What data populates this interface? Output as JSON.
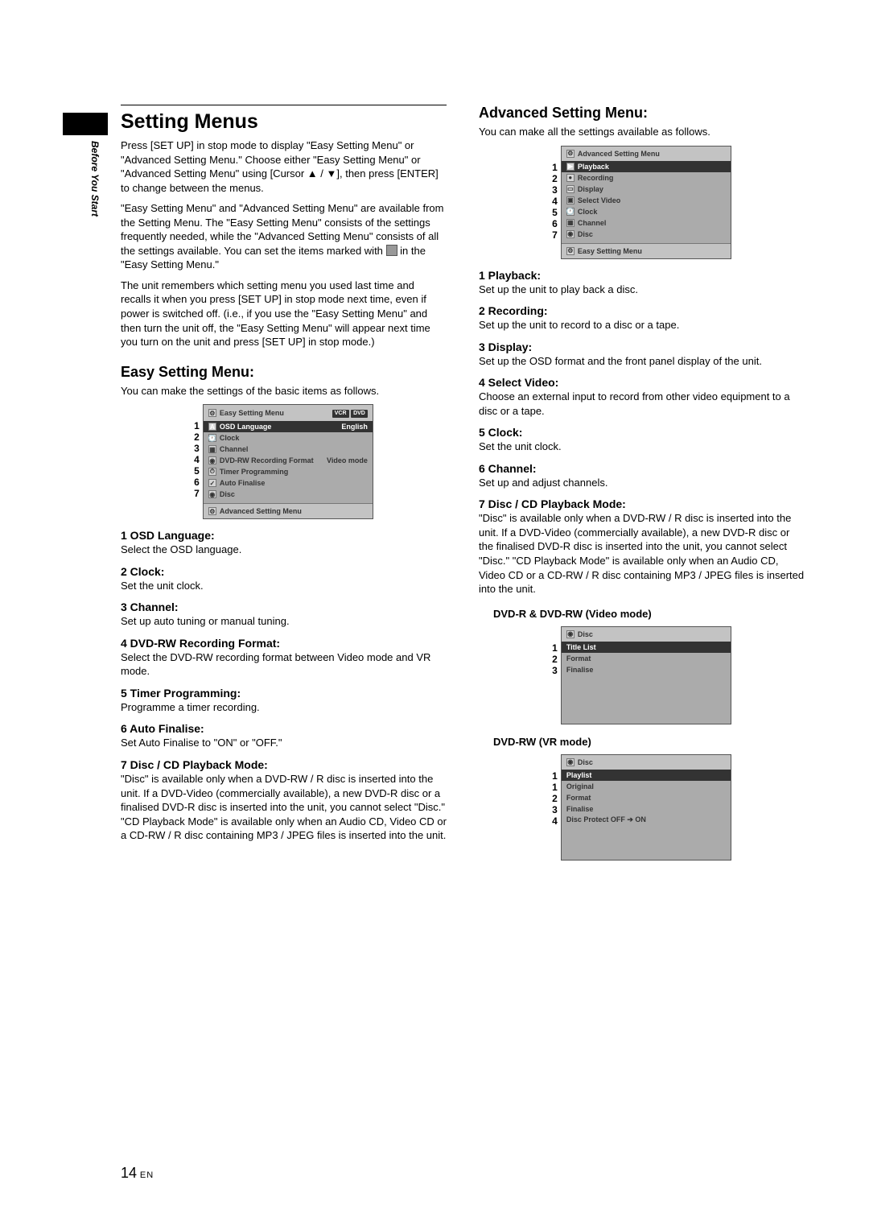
{
  "tab_label": "Before You Start",
  "left": {
    "title": "Setting Menus",
    "intro_a": "Press [SET UP] in stop mode to display \"Easy Setting Menu\" or \"Advanced Setting Menu.\" Choose either \"Easy Setting Menu\" or \"Advanced Setting Menu\" using [Cursor ▲ / ▼], then press [ENTER] to change between the menus.",
    "intro_b_pre": "\"Easy Setting Menu\" and \"Advanced Setting Menu\" are available from the Setting Menu. The \"Easy Setting Menu\" consists of the settings frequently needed, while the \"Advanced Setting Menu\" consists of all the settings available. You can set the items marked with ",
    "intro_b_post": " in the \"Easy Setting Menu.\"",
    "intro_c": "The unit remembers which setting menu you used last time and recalls it when you press [SET UP] in stop mode next time, even if power is switched off. (i.e., if you use the \"Easy Setting Menu\" and then turn the unit off, the \"Easy Setting Menu\" will appear next time you turn on the unit and press [SET UP] in stop mode.)",
    "easy_title": "Easy Setting Menu:",
    "easy_lead": "You can make the settings of the basic items as follows.",
    "easy_osd": {
      "title": "Easy Setting Menu",
      "badges": [
        "VCR",
        "DVD"
      ],
      "rows": [
        {
          "n": "1",
          "label": "OSD Language",
          "value": "English",
          "sel": true
        },
        {
          "n": "2",
          "label": "Clock"
        },
        {
          "n": "3",
          "label": "Channel"
        },
        {
          "n": "4",
          "label": "DVD-RW Recording Format",
          "value": "Video mode"
        },
        {
          "n": "5",
          "label": "Timer Programming"
        },
        {
          "n": "6",
          "label": "Auto Finalise"
        },
        {
          "n": "7",
          "label": "Disc"
        }
      ],
      "footer": "Advanced Setting Menu"
    },
    "items": [
      {
        "h": "1   OSD Language:",
        "d": "Select the OSD language."
      },
      {
        "h": "2   Clock:",
        "d": "Set the unit clock."
      },
      {
        "h": "3   Channel:",
        "d": "Set up auto tuning or manual tuning."
      },
      {
        "h": "4   DVD-RW Recording Format:",
        "d": "Select the DVD-RW recording format between Video mode and VR mode."
      },
      {
        "h": "5   Timer Programming:",
        "d": "Programme a timer recording."
      },
      {
        "h": "6   Auto Finalise:",
        "d": "Set Auto Finalise to \"ON\" or \"OFF.\""
      },
      {
        "h": "7   Disc / CD Playback Mode:",
        "d": "\"Disc\" is available only when a DVD-RW / R disc is inserted into the unit. If a DVD-Video (commercially available), a new DVD-R disc or a finalised DVD-R disc is inserted into the unit, you cannot select \"Disc.\" \"CD Playback Mode\" is available only when an Audio CD, Video CD or a CD-RW / R disc containing MP3 / JPEG files is inserted into the unit."
      }
    ]
  },
  "right": {
    "title": "Advanced Setting Menu:",
    "lead": "You can make all the settings available as follows.",
    "adv_osd": {
      "title": "Advanced Setting Menu",
      "rows": [
        {
          "n": "1",
          "label": "Playback",
          "sel": true
        },
        {
          "n": "2",
          "label": "Recording"
        },
        {
          "n": "3",
          "label": "Display"
        },
        {
          "n": "4",
          "label": "Select Video"
        },
        {
          "n": "5",
          "label": "Clock"
        },
        {
          "n": "6",
          "label": "Channel"
        },
        {
          "n": "7",
          "label": "Disc"
        }
      ],
      "footer": "Easy Setting Menu"
    },
    "items": [
      {
        "h": "1   Playback:",
        "d": "Set up the unit to play back a disc."
      },
      {
        "h": "2   Recording:",
        "d": "Set up the unit to record to a disc or a tape."
      },
      {
        "h": "3   Display:",
        "d": "Set up the OSD format and the front panel display of the unit."
      },
      {
        "h": "4   Select Video:",
        "d": "Choose an external input to record from other video equipment to a disc or a tape."
      },
      {
        "h": "5   Clock:",
        "d": "Set the unit clock."
      },
      {
        "h": "6   Channel:",
        "d": "Set up and adjust channels."
      },
      {
        "h": "7   Disc / CD Playback Mode:",
        "d": "\"Disc\" is available only when a DVD-RW / R disc is inserted into the unit. If a DVD-Video (commercially available), a new DVD-R disc or the finalised DVD-R disc is inserted into the unit, you cannot select \"Disc.\" \"CD Playback Mode\" is available only when an Audio CD, Video CD or a CD-RW / R disc containing MP3 / JPEG files is inserted into the unit."
      }
    ],
    "disc_video_label": "DVD-R & DVD-RW (Video mode)",
    "disc_video_osd": {
      "title": "Disc",
      "rows": [
        {
          "n": "1",
          "label": "Title List",
          "sel": true
        },
        {
          "n": "2",
          "label": "Format"
        },
        {
          "n": "3",
          "label": "Finalise"
        }
      ]
    },
    "disc_vr_label": "DVD-RW (VR mode)",
    "disc_vr_osd": {
      "title": "Disc",
      "rows": [
        {
          "n": "1",
          "label": "Playlist",
          "sel": true
        },
        {
          "n": "1",
          "label": "Original"
        },
        {
          "n": "2",
          "label": "Format"
        },
        {
          "n": "3",
          "label": "Finalise"
        },
        {
          "n": "4",
          "label": "Disc Protect OFF ➔ ON"
        }
      ]
    }
  },
  "page_number": "14",
  "page_lang": "EN"
}
